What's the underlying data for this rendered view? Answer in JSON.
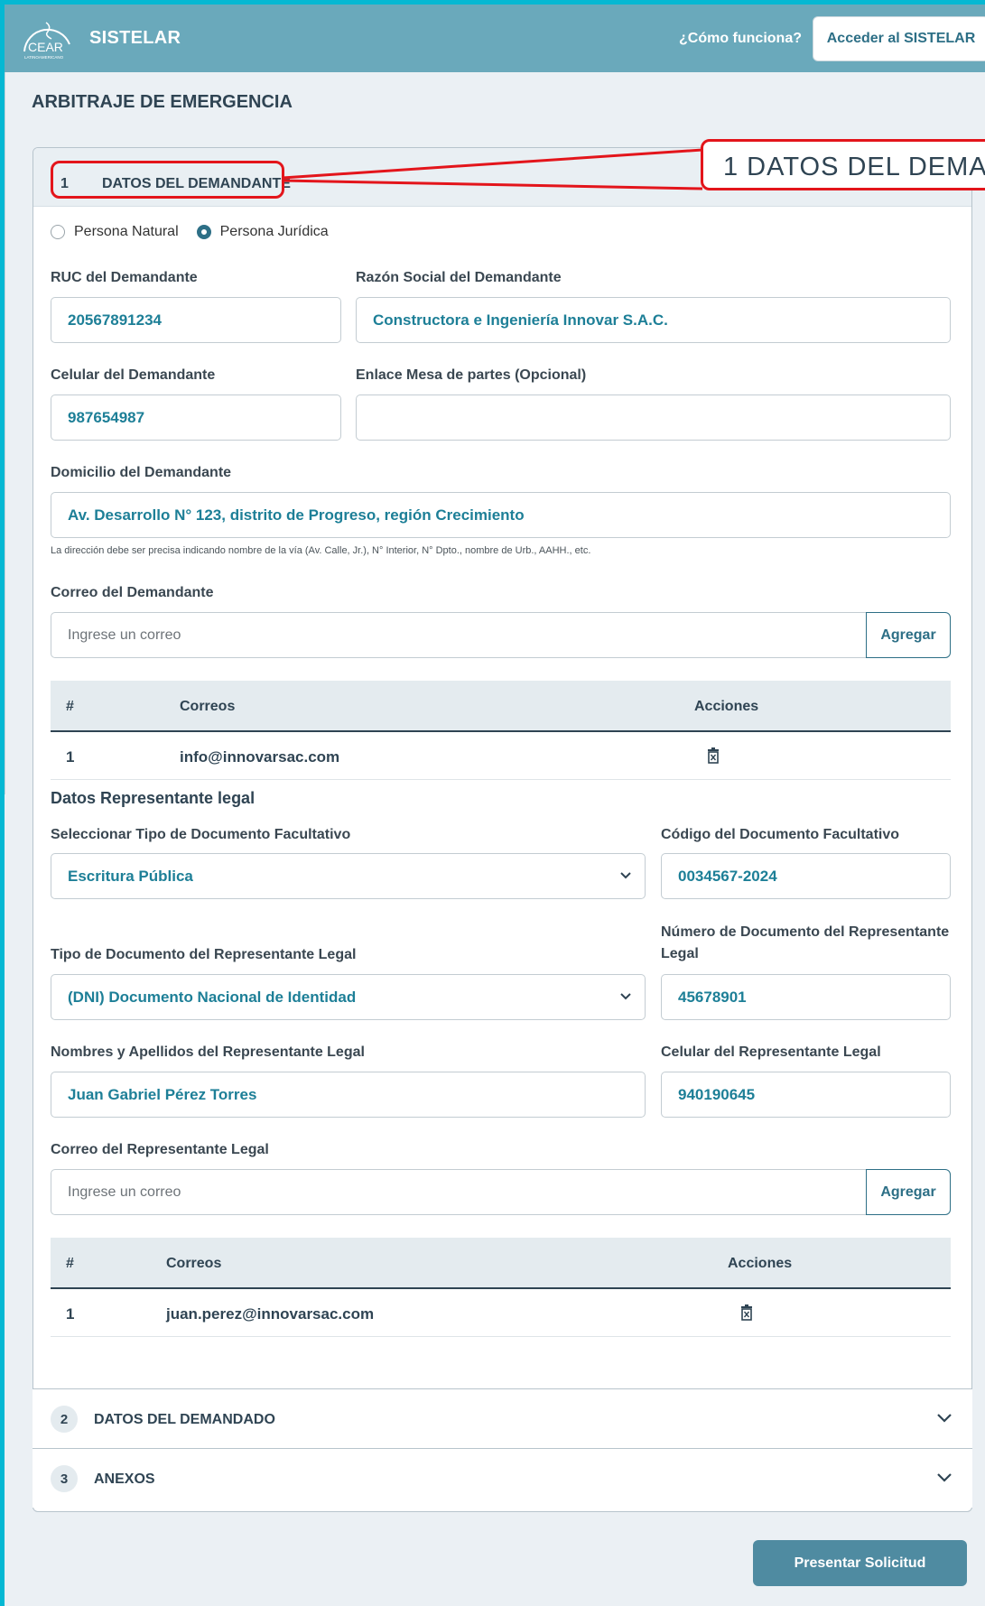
{
  "header": {
    "brand": "SISTELAR",
    "logo_text": "CEAR",
    "logo_sub": "LATINOAMERICANO",
    "how_link": "¿Cómo funciona?",
    "access_button": "Acceder al SISTELAR"
  },
  "page_title": "ARBITRAJE DE EMERGENCIA",
  "callout": {
    "text": "1  DATOS DEL DEMA"
  },
  "section1": {
    "num": "1",
    "title": "DATOS DEL DEMANDANTE",
    "radio_natural": "Persona Natural",
    "radio_juridica": "Persona Jurídica",
    "ruc_label": "RUC del Demandante",
    "ruc_value": "20567891234",
    "razon_label": "Razón Social del Demandante",
    "razon_value": "Constructora e Ingeniería Innovar S.A.C.",
    "celular_label": "Celular del Demandante",
    "celular_value": "987654987",
    "enlace_label": "Enlace Mesa de partes (Opcional)",
    "enlace_value": "",
    "domicilio_label": "Domicilio del Demandante",
    "domicilio_value": "Av. Desarrollo N° 123, distrito de Progreso, región Crecimiento",
    "domicilio_hint": "La dirección debe ser precisa indicando nombre de la vía (Av. Calle, Jr.), N° Interior, N° Dpto., nombre de Urb., AAHH., etc.",
    "correo_label": "Correo del Demandante",
    "correo_placeholder": "Ingrese un correo",
    "add_label": "Agregar",
    "table": {
      "headers": [
        "#",
        "Correos",
        "Acciones"
      ],
      "rows": [
        {
          "n": "1",
          "email": "info@innovarsac.com"
        }
      ]
    }
  },
  "rep": {
    "subtitle": "Datos Representante legal",
    "tipo_doc_fac_label": "Seleccionar Tipo de Documento Facultativo",
    "tipo_doc_fac_value": "Escritura Pública",
    "codigo_label": "Código del Documento Facultativo",
    "codigo_value": "0034567-2024",
    "tipo_doc_label": "Tipo de Documento del Representante Legal",
    "tipo_doc_value": "(DNI) Documento Nacional de Identidad",
    "num_doc_label": "Número de Documento del Representante Legal",
    "num_doc_value": "45678901",
    "nombres_label": "Nombres y Apellidos del Representante Legal",
    "nombres_value": "Juan Gabriel Pérez Torres",
    "celular_label": "Celular del Representante Legal",
    "celular_value": "940190645",
    "correo_label": "Correo del Representante Legal",
    "correo_placeholder": "Ingrese un correo",
    "add_label": "Agregar",
    "table": {
      "headers": [
        "#",
        "Correos",
        "Acciones"
      ],
      "rows": [
        {
          "n": "1",
          "email": "juan.perez@innovarsac.com"
        }
      ]
    }
  },
  "accordion": [
    {
      "num": "2",
      "title": "DATOS DEL DEMANDADO"
    },
    {
      "num": "3",
      "title": "ANEXOS"
    }
  ],
  "submit_button": "Presentar Solicitud",
  "colors": {
    "header": "#6aa9bb",
    "accent": "#2d6f86",
    "value_text": "#1d7f97",
    "highlight": "#e3151b"
  }
}
